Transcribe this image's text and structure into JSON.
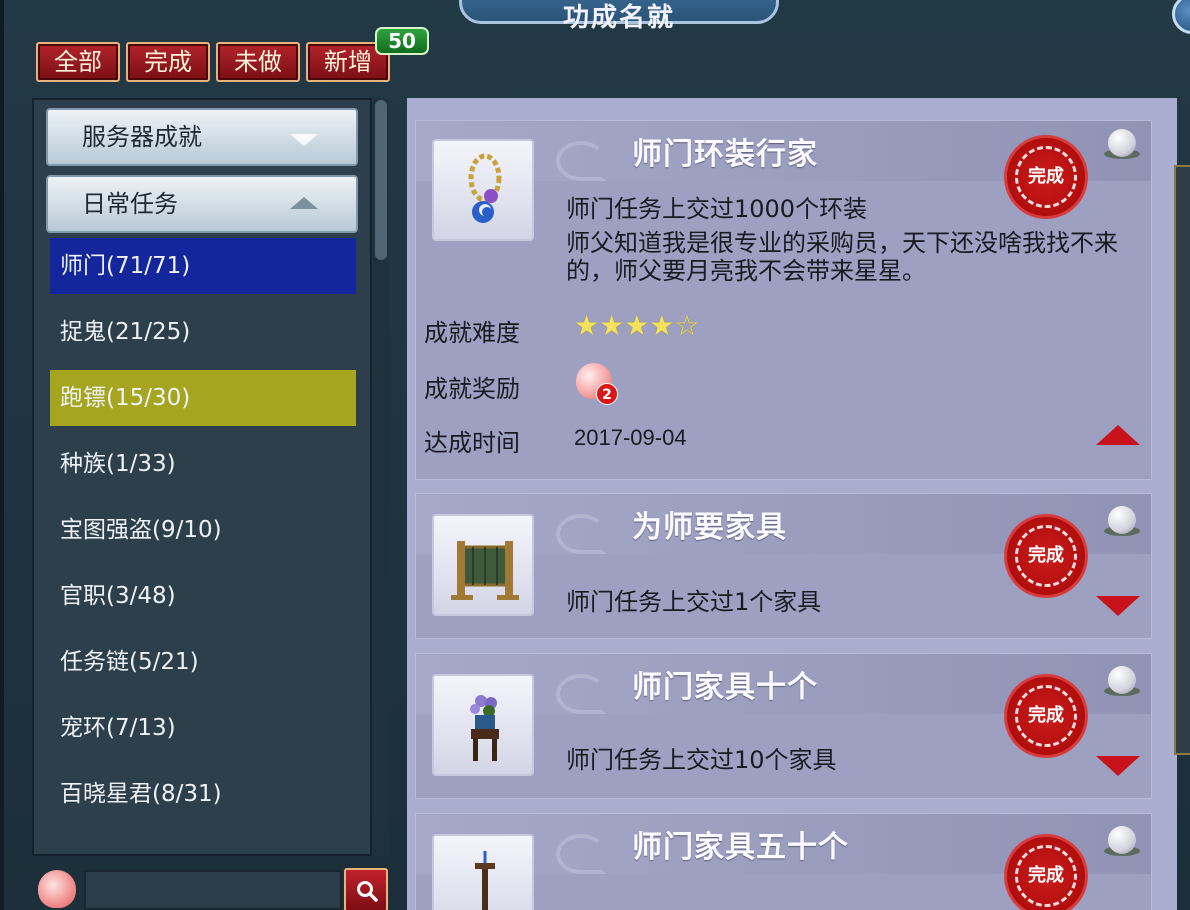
{
  "window": {
    "title": "功成名就"
  },
  "tabs": [
    {
      "label": "全部"
    },
    {
      "label": "完成"
    },
    {
      "label": "未做"
    },
    {
      "label": "新增"
    }
  ],
  "new_badge": "50",
  "dropdowns": [
    {
      "label": "服务器成就",
      "state": "collapsed"
    },
    {
      "label": "日常任务",
      "state": "expanded"
    }
  ],
  "categories": [
    {
      "label": "师门(71/71)",
      "state": "selected-blue"
    },
    {
      "label": "捉鬼(21/25)",
      "state": "normal"
    },
    {
      "label": "跑镖(15/30)",
      "state": "selected-olive"
    },
    {
      "label": "种族(1/33)",
      "state": "normal"
    },
    {
      "label": "宝图强盗(9/10)",
      "state": "normal"
    },
    {
      "label": "官职(3/48)",
      "state": "normal"
    },
    {
      "label": "任务链(5/21)",
      "state": "normal"
    },
    {
      "label": "宠环(7/13)",
      "state": "normal"
    },
    {
      "label": "百晓星君(8/31)",
      "state": "normal"
    }
  ],
  "search": {
    "value": "",
    "icon": "search-icon"
  },
  "achievements": [
    {
      "title": "师门环装行家",
      "desc": "师门任务上交过1000个环装",
      "flavor": "师父知道我是很专业的采购员，天下还没啥我找不来的，师父要月亮我不会带来星星。",
      "stamp": "完成",
      "expanded": true,
      "difficulty_label": "成就难度",
      "difficulty_stars": 4,
      "difficulty_max": 5,
      "star_text": "★★★★☆",
      "reward_label": "成就奖励",
      "reward_count": "2",
      "time_label": "达成时间",
      "time": "2017-09-04",
      "icon": "necklace-icon"
    },
    {
      "title": "为师要家具",
      "desc": "师门任务上交过1个家具",
      "stamp": "完成",
      "expanded": false,
      "icon": "screen-furniture-icon"
    },
    {
      "title": "师门家具十个",
      "desc": "师门任务上交过10个家具",
      "stamp": "完成",
      "expanded": false,
      "icon": "flower-stand-icon"
    },
    {
      "title": "师门家具五十个",
      "stamp": "完成",
      "expanded": false,
      "icon": "lamp-stand-icon"
    }
  ],
  "colors": {
    "tab_red": "#b3232b",
    "selected_blue": "#14269b",
    "selected_olive": "#a6a520",
    "card_bg": "#9ea0c2",
    "stamp_red": "#cc1c1c"
  }
}
